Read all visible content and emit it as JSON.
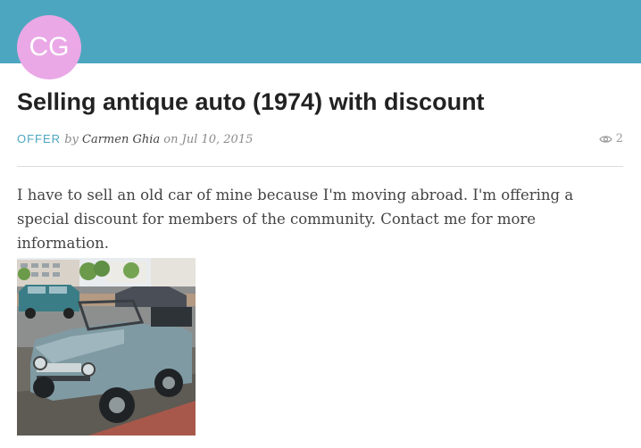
{
  "header": {
    "avatar_initials": "CG",
    "avatar_color": "#eaa8e6",
    "bar_color": "#4da6bf"
  },
  "post": {
    "title": "Selling antique auto (1974) with discount",
    "category": "OFFER",
    "by_label": "by",
    "author": "Carmen Ghia",
    "on_label": "on",
    "date": "Jul 10, 2015",
    "views": "2",
    "views_icon": "eye-icon",
    "body": "I have to sell an old car of mine because I'm moving abroad. I'm offering a special discount for members of the community. Contact me for more information.",
    "image_icon": "car-photo"
  }
}
